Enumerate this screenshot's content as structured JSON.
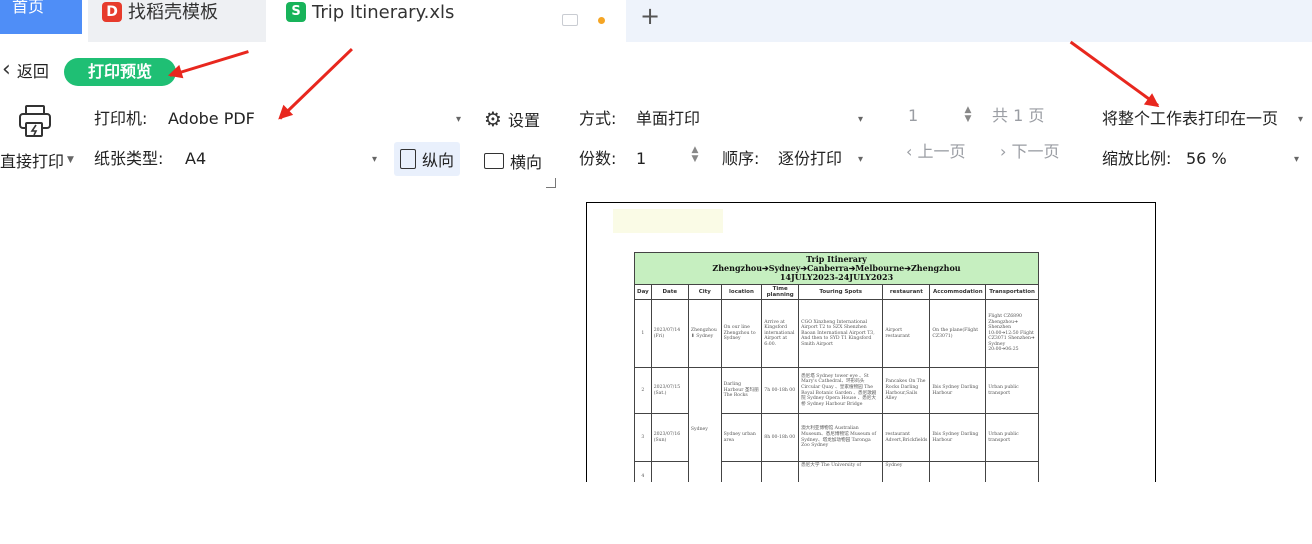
{
  "tabs": {
    "home": "首页",
    "template": "找稻壳模板",
    "file": "Trip Itinerary.xls",
    "template_icon": "wps-d-icon",
    "file_icon": "spreadsheet-icon",
    "add": "+"
  },
  "header": {
    "back_label": "返回",
    "mode_label": "打印预览"
  },
  "toolbar": {
    "direct_print": "直接打印",
    "printer_label": "打印机:",
    "printer_value": "Adobe PDF",
    "paper_label": "纸张类型:",
    "paper_value": "A4",
    "settings": "设置",
    "portrait": "纵向",
    "landscape": "横向",
    "method_label": "方式:",
    "method_value": "单面打印",
    "copies_label": "份数:",
    "copies_value": "1",
    "order_label": "顺序:",
    "order_value": "逐份打印",
    "page_value": "1",
    "page_total": "共 1 页",
    "prev_page": "上一页",
    "next_page": "下一页",
    "scale_mode": "将整个工作表打印在一页",
    "zoom_label": "缩放比例:",
    "zoom_value": "56 %"
  },
  "colors": {
    "accent": "#1fbf74",
    "annotation_arrow": "#e8271e",
    "title_fill": "#c6efc0",
    "tab_home": "#4f8ef7"
  },
  "sheet": {
    "title_line1": "Trip Itinerary",
    "title_line2": "Zhengzhou➔Sydney➔Canberra➔Melbourne➔Zhengzhou",
    "title_line3": "14JULY2023-24JULY2023",
    "headers": [
      "Day",
      "Date",
      "City",
      "location",
      "Time planning",
      "Touring Spots",
      "restaurant",
      "Accommodation",
      "Transportation"
    ],
    "rows": [
      {
        "day": "1",
        "date": "2023/07/14 (Fri)",
        "city": "Zhengzhou ⬇ Sydney",
        "location": "On our line Zhengzhou to Sydney",
        "time": "Arrive at Kingsford international Airport at 6:00.",
        "spots": "CGO Xinzheng International Airport T2 to SZX Shenzhen Baoan International Airport T3, And then to SYD T1 Kingsford Smith Airport",
        "restaurant": "Airport restaurant",
        "accommodation": "On the plane(Flight CZ3071)",
        "transport": "Flight CZ6890 Zhengzhou➔ Shenzhen 10:00➔12:50 Flight CZ3071 Shenzhen➔ Sydney 20:00➔06:25"
      },
      {
        "day": "2",
        "date": "2023/07/15 (Sat.)",
        "city": "",
        "location": "Darling Harbour 圣玛丽 The Rocks",
        "time": "7h 00-18h 00",
        "spots": "悉尼塔 Sydney tower eye 、St Mary's Cathedral、环形码头 Circular Quay 、皇家植物园 The Royal Botanic Garden 、悉尼歌剧院 Sydney Opera House 、悉尼大桥 Sydney Harbour Bridge",
        "restaurant": "Pancakes On The Rocks Darling Harbour,Sails Alley",
        "accommodation": "Ibis Sydney Darling Harbour",
        "transport": "Urban public transport"
      },
      {
        "day": "3",
        "date": "2023/07/16 (Sun)",
        "city": "Sydney",
        "location": "Sydney urban area",
        "time": "8h 00-18h 00",
        "spots": "澳大利亚博物馆 Australian Museum、悉尼博物馆 Museum of Sydney、塔龙加动物园 Taronga Zoo Sydney",
        "restaurant": "restaurant Advert,Brickfields",
        "accommodation": "Ibis Sydney Darling Harbour",
        "transport": "Urban public transport"
      },
      {
        "day": "4",
        "date": "",
        "city": "",
        "location": "",
        "time": "",
        "spots": "悉尼大学 The University of",
        "restaurant": "Sydney",
        "accommodation": "",
        "transport": ""
      }
    ]
  }
}
